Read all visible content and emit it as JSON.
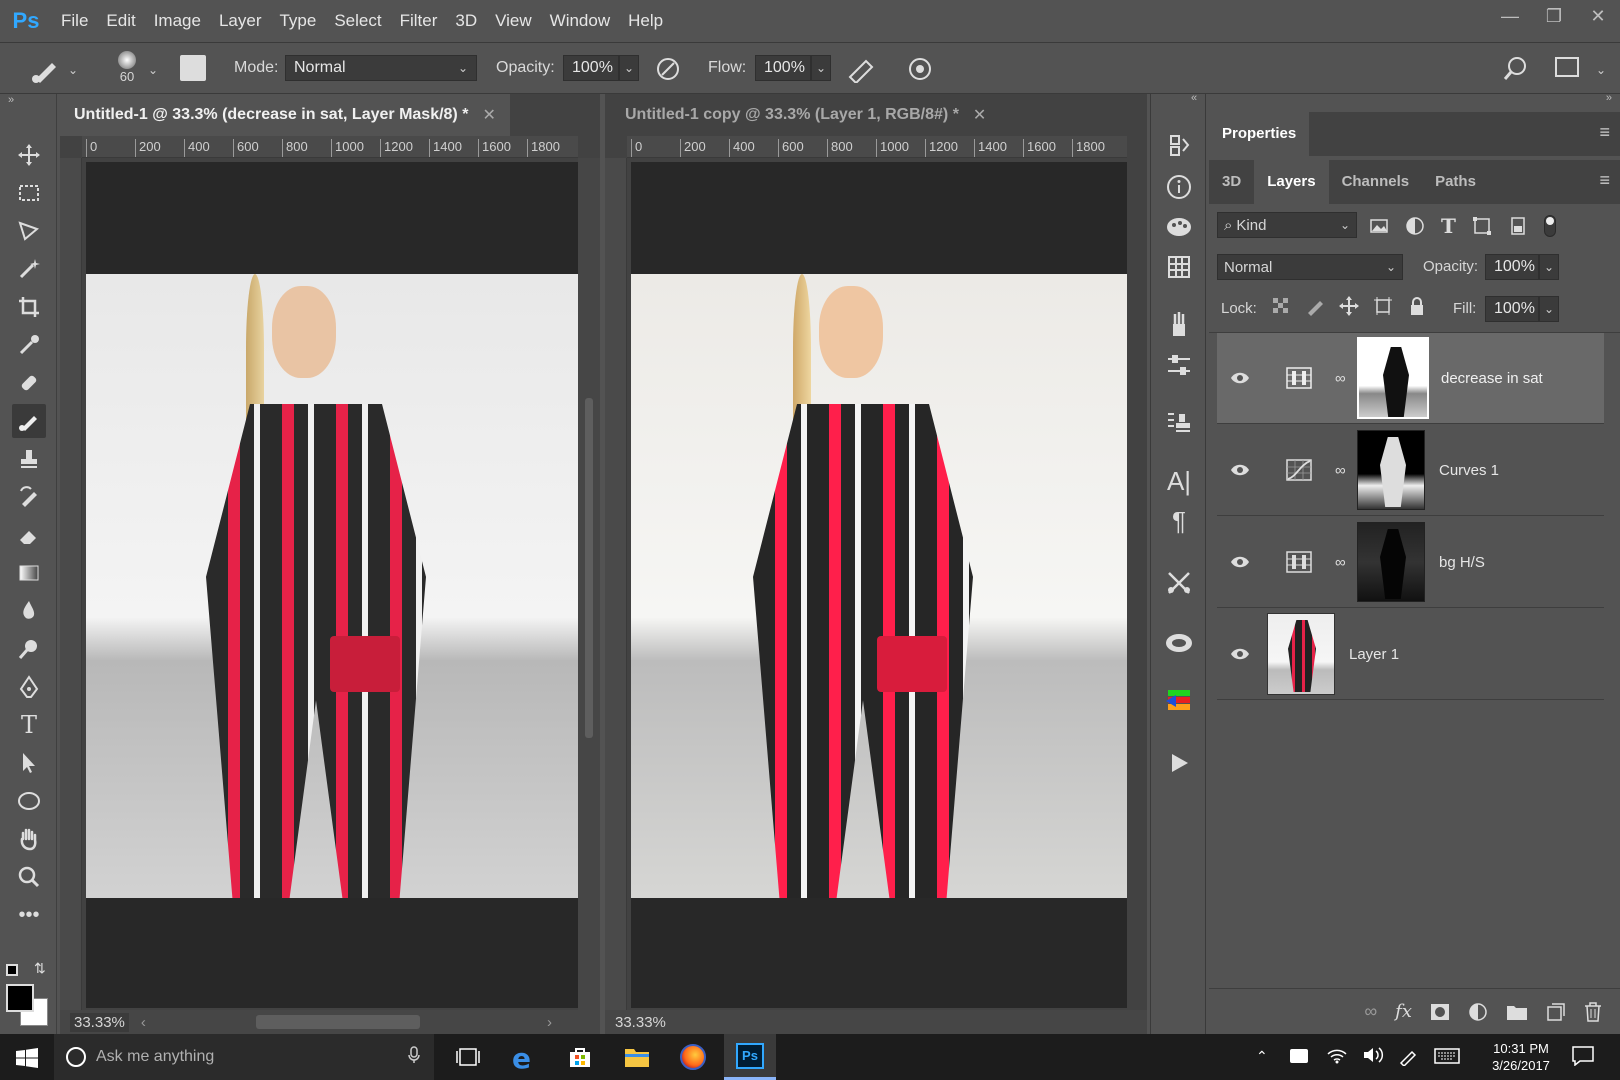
{
  "app": {
    "logo": "Ps"
  },
  "menu": [
    "File",
    "Edit",
    "Image",
    "Layer",
    "Type",
    "Select",
    "Filter",
    "3D",
    "View",
    "Window",
    "Help"
  ],
  "options": {
    "brush_size": "60",
    "mode_label": "Mode:",
    "mode_value": "Normal",
    "opacity_label": "Opacity:",
    "opacity_value": "100%",
    "flow_label": "Flow:",
    "flow_value": "100%"
  },
  "documents": [
    {
      "tab": "Untitled-1 @ 33.3% (decrease in sat, Layer Mask/8) *",
      "zoom": "33.33%",
      "active": true
    },
    {
      "tab": "Untitled-1 copy @ 33.3% (Layer 1, RGB/8#) *",
      "zoom": "33.33%",
      "active": false
    }
  ],
  "ruler_ticks": [
    "0",
    "200",
    "400",
    "600",
    "800",
    "1000",
    "1200",
    "1400",
    "1600",
    "1800"
  ],
  "panel": {
    "header": "Properties",
    "tabs": [
      "3D",
      "Layers",
      "Channels",
      "Paths"
    ],
    "active_tab": "Layers",
    "kind_label": "Kind",
    "blend_mode": "Normal",
    "opacity_label": "Opacity:",
    "opacity_value": "100%",
    "lock_label": "Lock:",
    "fill_label": "Fill:",
    "fill_value": "100%",
    "layers": [
      {
        "name": "decrease in sat",
        "type": "hue-saturation",
        "selected": true
      },
      {
        "name": "Curves 1",
        "type": "curves",
        "selected": false
      },
      {
        "name": "bg H/S",
        "type": "hue-saturation",
        "selected": false
      },
      {
        "name": "Layer 1",
        "type": "pixel",
        "selected": false
      }
    ]
  },
  "taskbar": {
    "search_placeholder": "Ask me anything",
    "time": "10:31 PM",
    "date": "3/26/2017"
  },
  "colors": {
    "accent": "#31a8ff",
    "panel_bg": "#535353",
    "canvas_bg": "#282828"
  }
}
